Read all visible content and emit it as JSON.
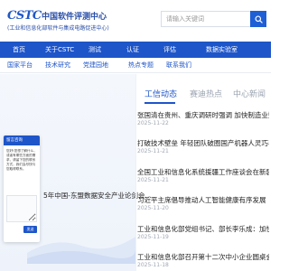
{
  "header": {
    "logo_mark": "CSTC",
    "logo_name": "中国软件评测中心",
    "logo_subtitle": "(工业和信息化部软件与集成电路促进中心)",
    "search_placeholder": "请输入关键词",
    "search_icon": "search-icon"
  },
  "nav": {
    "items": [
      "首页",
      "关于CSTC",
      "测试",
      "认证",
      "评估",
      "数据实验室"
    ]
  },
  "subnav": {
    "items": [
      "国家平台",
      "技术研究",
      "党建园地",
      "热点专题",
      "联系我们"
    ]
  },
  "tabs": {
    "items": [
      "工信动态",
      "赛迪热点",
      "中心新闻"
    ],
    "active": "工信动态"
  },
  "news": [
    {
      "title": "张国清在贵州、重庆调研时强调 加快制造业数智化…",
      "date": "2025-11-22"
    },
    {
      "title": "打破技术壁垒 年轻团队破圈国产机器人灵巧手",
      "date": "2025-11-21"
    },
    {
      "title": "全国工业和信息化系统援疆工作座谈会在新疆召开",
      "date": "2025-11-21"
    },
    {
      "title": "习近平主席倡导推动人工智能健康有序发展",
      "date": "2025-11-20"
    },
    {
      "title": "工业和信息化部党组书记、部长李乐成：加快推进…",
      "date": "2025-11-19"
    },
    {
      "title": "工业和信息化部召开第十二次中小企业圆桌会议",
      "date": "2025-11-18"
    }
  ],
  "left_banner": {
    "caption": "5年中国-东盟数据安全产业论剑会…"
  },
  "popup": {
    "title": "留言咨询",
    "body": "您好!您想了解什么，或者有哪些方面的需求，请留下您的联系方式，我们会尽快与您取得联系。",
    "send_label": "发送"
  },
  "colors": {
    "primary": "#1e55c9",
    "nav_bg": "#1e55c9",
    "muted_text": "#9aa3b0"
  }
}
